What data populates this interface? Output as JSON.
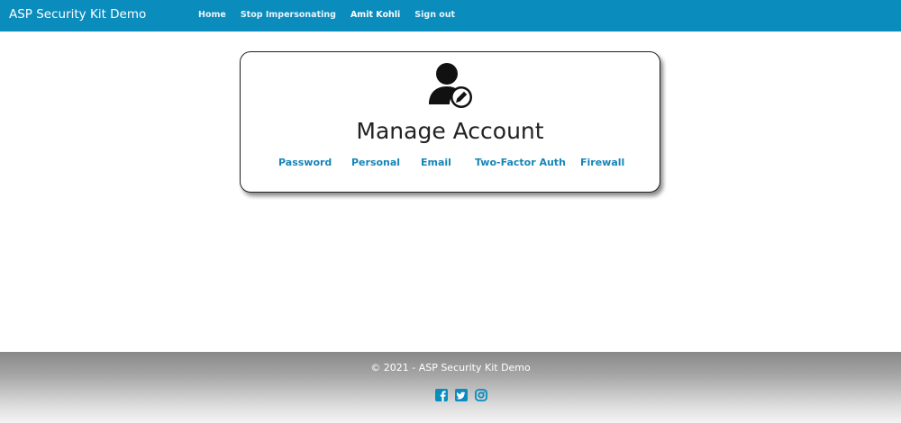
{
  "navbar": {
    "brand": "ASP Security Kit Demo",
    "links": [
      {
        "label": "Home"
      },
      {
        "label": "Stop Impersonating"
      },
      {
        "label": "Amit Kohli"
      },
      {
        "label": "Sign out"
      }
    ],
    "background_color": "#0a8cbd"
  },
  "card": {
    "icon": "user-edit-icon",
    "title": "Manage Account",
    "links": [
      {
        "label": "Password"
      },
      {
        "label": "Personal"
      },
      {
        "label": "Email"
      },
      {
        "label": "Two-Factor Auth"
      },
      {
        "label": "Firewall"
      }
    ],
    "link_color": "#1685b8"
  },
  "footer": {
    "copyright": "© 2021 - ASP Security Kit Demo",
    "social": [
      {
        "icon": "facebook-icon"
      },
      {
        "icon": "twitter-icon"
      },
      {
        "icon": "instagram-icon"
      }
    ],
    "icon_color": "#0a8cbd"
  }
}
